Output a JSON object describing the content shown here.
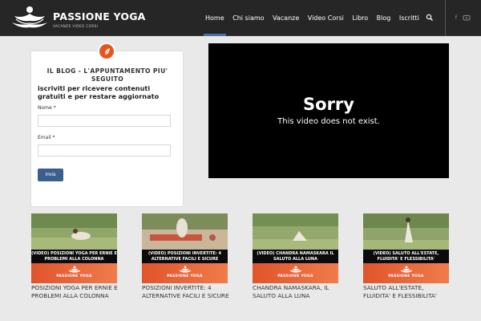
{
  "header": {
    "brand_title": "PASSIONE YOGA",
    "brand_subtitle": "VACANZE VIDEO CORSI",
    "nav": [
      "Home",
      "Chi siamo",
      "Vacanze",
      "Video Corsi",
      "Libro",
      "Blog",
      "Iscritti"
    ],
    "active_nav": "Home",
    "icons": [
      "search-icon",
      "facebook-icon",
      "youtube-icon"
    ]
  },
  "sidebar": {
    "badge_icon": "feather-icon",
    "title": "IL BLOG - L'APPUNTAMENTO PIU' SEGUITO",
    "subtitle": "iscriviti per ricevere contenuti gratuiti e per restare aggiornato",
    "name_label": "Nome *",
    "email_label": "Email *",
    "submit_label": "Invia"
  },
  "video": {
    "title": "Sorry",
    "message": "This video does not exist."
  },
  "posts": [
    {
      "label": "(VIDEO) POSIZIONI YOGA PER ERNIE E PROBLEMI ALLA COLONNA",
      "brand": "PASSIONE YOGA",
      "caption": "POSIZIONI YOGA PER ERNIE E PROBLEMI ALLA COLONNA"
    },
    {
      "label": "(VIDEO) POSIZIONI INVERTITE: 4 ALTERNATIVE FACILI E SICURE",
      "brand": "PASSIONE YOGA",
      "caption": "POSIZIONI INVERTITE: 4 ALTERNATIVE FACILI E SICURE"
    },
    {
      "label": "(VIDEO) CHANDRA NAMASKARA IL SALUTO ALLA LUNA",
      "brand": "PASSIONE YOGA",
      "caption": "CHANDRA NAMASKARA, IL SALUTO ALLA LUNA"
    },
    {
      "label": "(VIDEO) SALUTO ALL'ESTATE, FLUIDITA' E FLESSIBILITA'",
      "brand": "PASSIONE YOGA",
      "caption": "SALUTO ALL'ESTATE, FLUIDITA' E FLESSIBILITA'"
    }
  ],
  "colors": {
    "header_bg": "#262626",
    "accent": "#e8551c",
    "button": "#3a5f8f",
    "nav_active": "#4a6fa5"
  }
}
